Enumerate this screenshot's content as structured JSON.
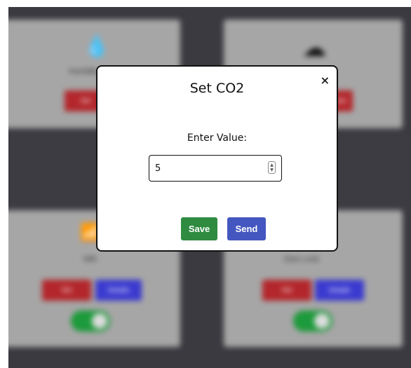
{
  "background": {
    "cards": [
      {
        "id": "humidity",
        "icon": "water-drop-icon",
        "label": "Humidity",
        "buttons": [
          "Set"
        ]
      },
      {
        "id": "cloud",
        "icon": "cloud-icon",
        "label": "",
        "buttons": [
          "Set"
        ]
      },
      {
        "id": "wifi",
        "icon": "wifi-icon",
        "label": "Wifi",
        "buttons": [
          "Set",
          "Details"
        ],
        "toggle_on": true
      },
      {
        "id": "door-lock",
        "icon": "lock-icon",
        "label": "Door Lock",
        "buttons": [
          "Set",
          "Details"
        ],
        "toggle_on": true
      }
    ],
    "colors": {
      "overlay": "#3a3a40",
      "card": "#a6a6a6",
      "red": "#b3262b",
      "blue": "#3a3ad0",
      "toggle": "#1d9a3b"
    }
  },
  "modal": {
    "title": "Set CO2",
    "close_glyph": "×",
    "label": "Enter Value:",
    "input": {
      "value": "5",
      "placeholder": ""
    },
    "save_label": "Save",
    "send_label": "Send",
    "colors": {
      "save": "#2e8b3f",
      "send": "#4457c0"
    }
  }
}
